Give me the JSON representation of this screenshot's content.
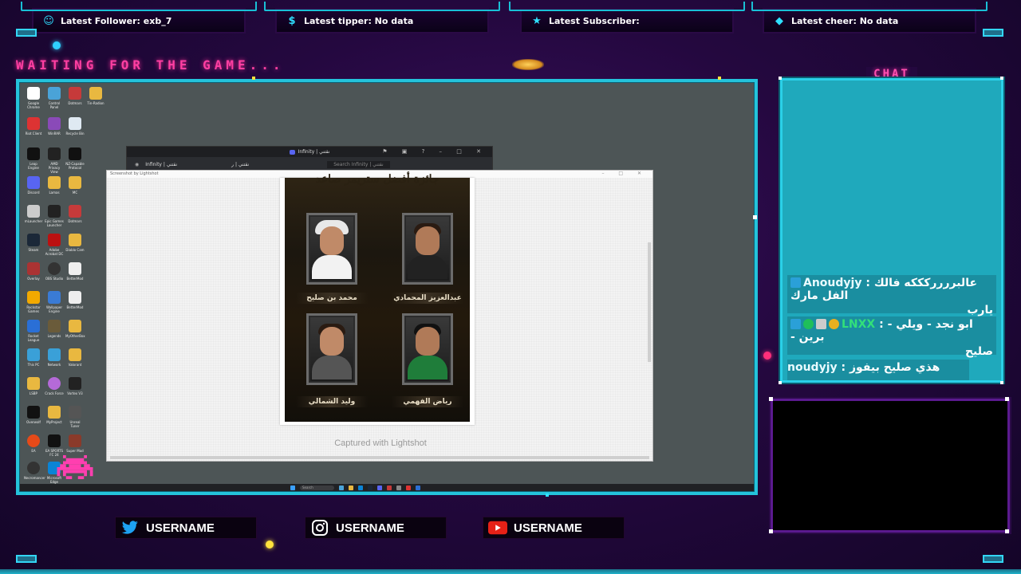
{
  "alerts": {
    "follower": "Latest Follower: exb_7",
    "tipper": "Latest tipper: No data",
    "subscriber": "Latest Subscriber:",
    "cheer": "Latest cheer: No data"
  },
  "status_text": "WAITING FOR THE GAME...",
  "chat": {
    "title": "CHAT",
    "messages": [
      {
        "user": "Anoudyjy",
        "sep": " : ",
        "text": "عالبرررركككه فالك الفل مارك",
        "text2": "يارب"
      },
      {
        "user": "LNXX",
        "sep": " : ",
        "text": "ابو نجد - ويلي - برين -",
        "text2": "صليح"
      },
      {
        "user": "noudyjy",
        "sep": " : ",
        "text": "هذي صليح بيفوز"
      }
    ]
  },
  "discord": {
    "title": "Infinity | نقتني",
    "server": "Infinity | نقتني",
    "channel": "نقتني | ر",
    "search": "Search Infinity | نقتني"
  },
  "lightshot": {
    "window_title": "Screenshot by Lightshot",
    "captured_text": "Captured with Lightshot",
    "poster_title": "جائزة أفضل ستريمر صاعد",
    "nominees": [
      "محمد بن صليح",
      "عبدالعزيز المحمادي",
      "وليد الشمالي",
      "رياض الفهمي"
    ]
  },
  "desktop_icons": [
    "Google Chrome",
    "Control Panel",
    "Dotmars",
    "Tin-Radion",
    "Riot Client",
    "WinRAR",
    "Recycle Bin",
    "Leap Engine",
    "AMD Privacy View",
    "NZ-Capable Protocol",
    "Discord",
    "Lamas",
    "MC",
    "mLauncher",
    "Epic Games Launcher",
    "Dotmars",
    "Steam",
    "Adobe Acrobat DC",
    "Diablo Cam",
    "Overlay",
    "OBS Studio",
    "BetterMod",
    "Rockstar Games",
    "Wallpaper Engine",
    "BetterMod",
    "Rocket League",
    "Legends",
    "MyOtherBox",
    "This PC",
    "Network",
    "Valorant",
    "LSBP",
    "Crack Force",
    "Vortex V3",
    "Overwolf",
    "MyProject",
    "Unreal Tuner",
    "EA",
    "EA SPORTS FC 24",
    "Super Mod",
    "Necromancer",
    "Microsoft Edge"
  ],
  "taskbar": {
    "search": "Search"
  },
  "social": {
    "twitter": "USERNAME",
    "instagram": "USERNAME",
    "youtube": "USERNAME"
  },
  "colors": {
    "accent_cyan": "#24c3db",
    "accent_pink": "#ff3fa2",
    "background": "#24083f",
    "chat_bg": "#1fa9bc"
  }
}
